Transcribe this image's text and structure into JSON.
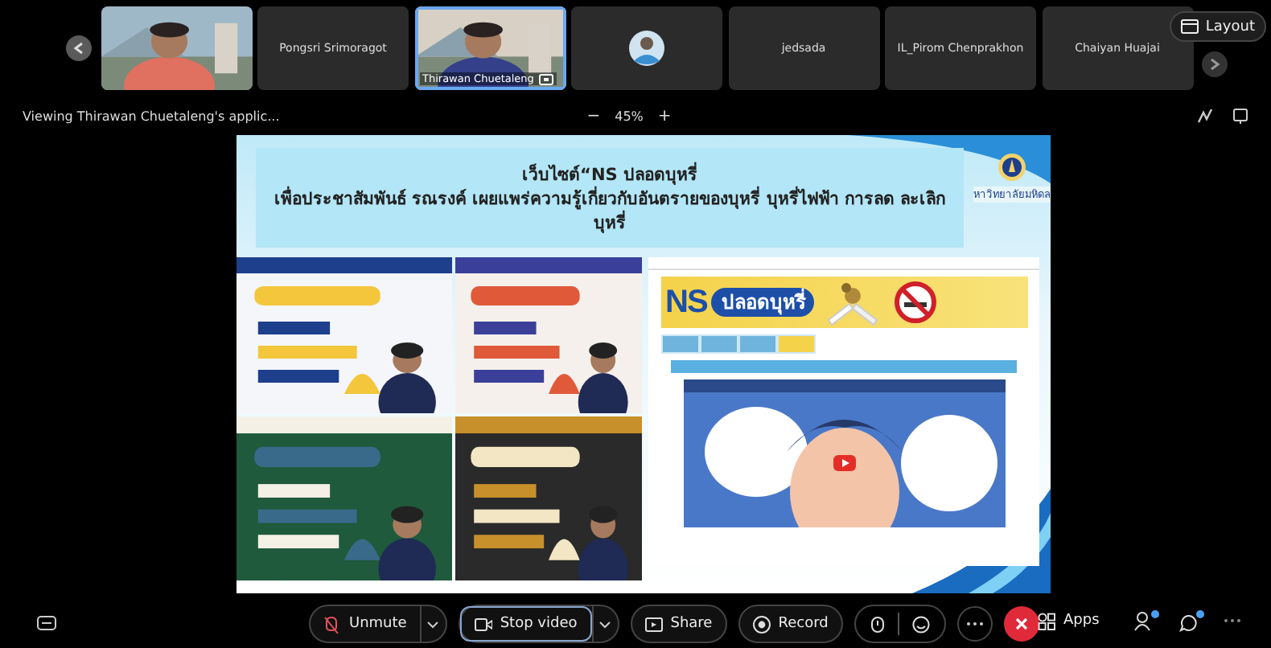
{
  "participants": [
    {
      "kind": "video",
      "active": false
    },
    {
      "kind": "name",
      "name": "Pongsri Srimoragot",
      "active": false
    },
    {
      "kind": "video",
      "name": "Thirawan Chuetaleng",
      "active": true
    },
    {
      "kind": "avatar",
      "active": false
    },
    {
      "kind": "name",
      "name": "jedsada",
      "active": false
    },
    {
      "kind": "name",
      "name": "IL_Pirom Chenprakhon",
      "active": false
    },
    {
      "kind": "name",
      "name": "Chaiyan Huajai",
      "active": false
    }
  ],
  "layout_button": "Layout",
  "viewing": "Viewing Thirawan Chuetaleng's applic...",
  "zoom": {
    "minus": "−",
    "value": "45%",
    "plus": "+"
  },
  "slide": {
    "title": "เว็บไซต์“NS ปลอดบุหรี่",
    "subtitle": "เพื่อประชาสัมพันธ์ รณรงค์ เผยแพร่ความรู้เกี่ยวกับอันตรายของบุหรี่ บุหรี่ไฟฟ้า การลด ละเลิก บุหรี่",
    "logo_text": "หาวิทยาลัยมหิดล",
    "banner": {
      "brand": "NS",
      "tagline": "ปลอดบุหรี่"
    },
    "site_tabs": [
      {
        "selected": false
      },
      {
        "selected": false
      },
      {
        "selected": false
      },
      {
        "selected": true
      }
    ]
  },
  "toolbar": [
    {
      "kind": "unmute",
      "label": "Unmute",
      "dropdown": true,
      "focused": false
    },
    {
      "kind": "video",
      "label": "Stop video",
      "dropdown": true,
      "focused": true
    },
    {
      "kind": "share",
      "label": "Share",
      "dropdown": false,
      "focused": false
    },
    {
      "kind": "record",
      "label": "Record",
      "dropdown": false,
      "focused": false
    }
  ],
  "apps": "Apps"
}
